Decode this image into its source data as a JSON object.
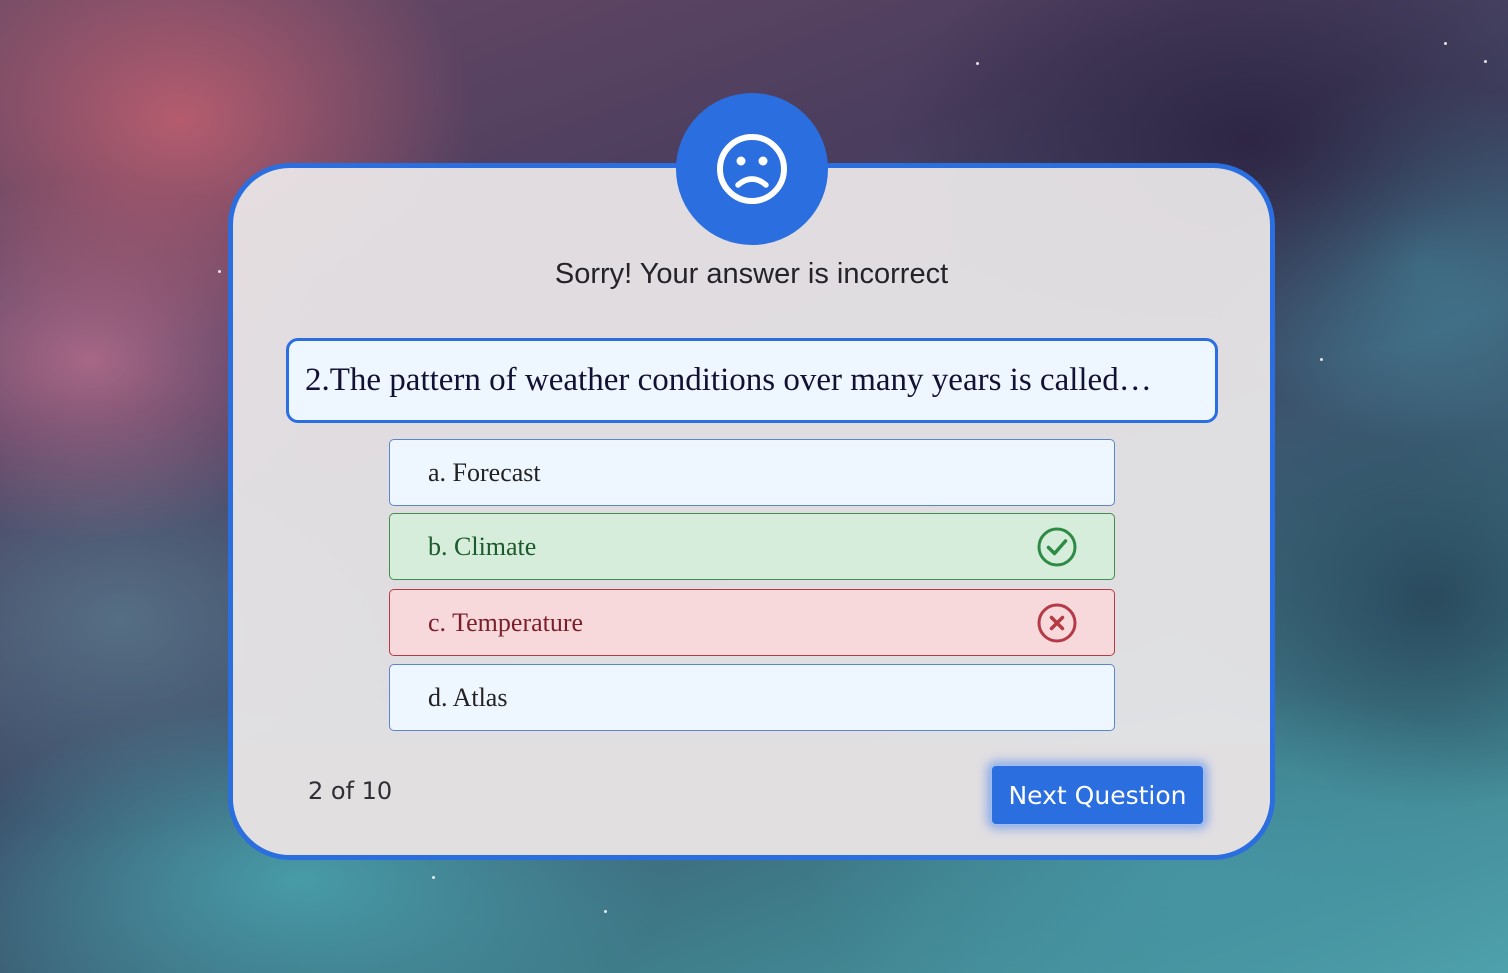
{
  "result": {
    "title": "Sorry! Your answer is incorrect",
    "icon": "sad-face-icon"
  },
  "question": {
    "number": 2,
    "text": "2.The pattern of weather conditions over many years is called…"
  },
  "options": [
    {
      "label": "a. Forecast",
      "state": "default"
    },
    {
      "label": "b. Climate",
      "state": "correct",
      "icon": "check-circle-icon"
    },
    {
      "label": "c. Temperature",
      "state": "incorrect",
      "icon": "x-circle-icon"
    },
    {
      "label": "d. Atlas",
      "state": "default"
    }
  ],
  "footer": {
    "counter": "2 of 10",
    "next_label": "Next Question"
  },
  "colors": {
    "accent": "#2a6ee0",
    "correct": "#2e8b45",
    "incorrect": "#b53a47",
    "option_bg": "#eef6ff"
  }
}
